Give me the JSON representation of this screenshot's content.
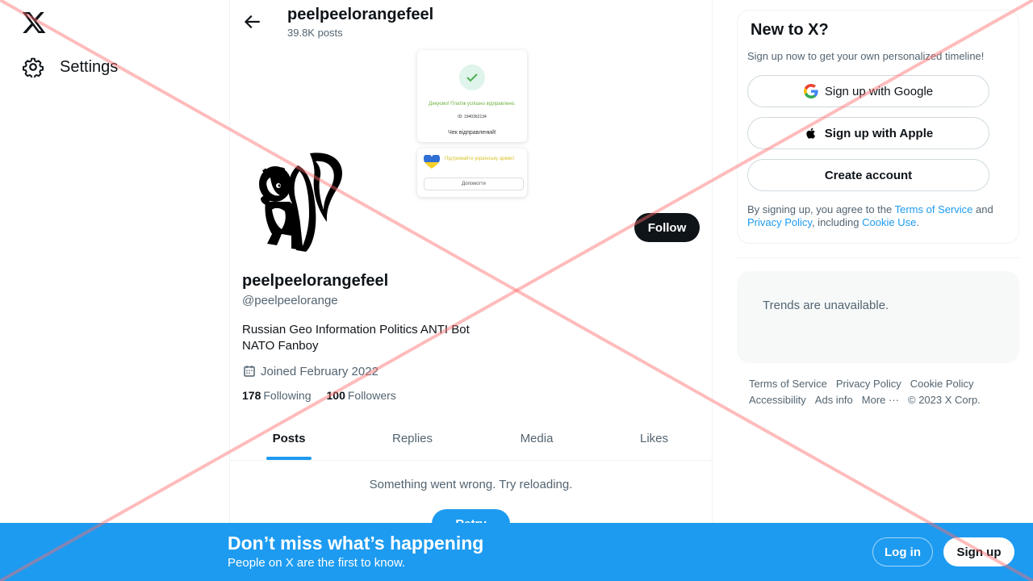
{
  "nav": {
    "logo_icon": "x-logo-icon",
    "settings_label": "Settings"
  },
  "header": {
    "name": "peelpeelorangefeel",
    "posts": "39.8K posts"
  },
  "banner": {
    "success_text": "Дякуємо! Платіж успішно відправлено.",
    "id_text": "ID: 1940362134",
    "sent_text": "Чек відправлений!",
    "support_text": "Підтримайте українську армію!",
    "help_button": "Допомогти"
  },
  "profile": {
    "follow_label": "Follow",
    "name": "peelpeelorangefeel",
    "handle": "@peelpeelorange",
    "bio": "Russian Geo Information Politics   ANTI Bot\nNATO Fanboy",
    "joined": "Joined February 2022",
    "following_count": "178",
    "following_label": "Following",
    "followers_count": "100",
    "followers_label": "Followers"
  },
  "tabs": [
    "Posts",
    "Replies",
    "Media",
    "Likes"
  ],
  "feed": {
    "error": "Something went wrong. Try reloading.",
    "retry_label": "Retry"
  },
  "signup": {
    "title": "New to X?",
    "subtitle": "Sign up now to get your own personalized timeline!",
    "google_label": "Sign up with Google",
    "apple_label": "Sign up with Apple",
    "create_label": "Create account",
    "legal_prefix": "By signing up, you agree to the ",
    "tos": "Terms of Service",
    "legal_and": " and ",
    "privacy": "Privacy Policy",
    "legal_including": ", including ",
    "cookie": "Cookie Use",
    "legal_end": "."
  },
  "trends": {
    "message": "Trends are unavailable."
  },
  "footer": {
    "links": [
      "Terms of Service",
      "Privacy Policy",
      "Cookie Policy",
      "Accessibility",
      "Ads info",
      "More ···"
    ],
    "copyright": "© 2023 X Corp."
  },
  "bottom_bar": {
    "title": "Don’t miss what’s happening",
    "subtitle": "People on X are the first to know.",
    "login_label": "Log in",
    "signup_label": "Sign up"
  },
  "colors": {
    "accent": "#1d9bf0",
    "text_primary": "#0f1419",
    "text_secondary": "#536471",
    "overlay_x": "#ff6b6b"
  }
}
